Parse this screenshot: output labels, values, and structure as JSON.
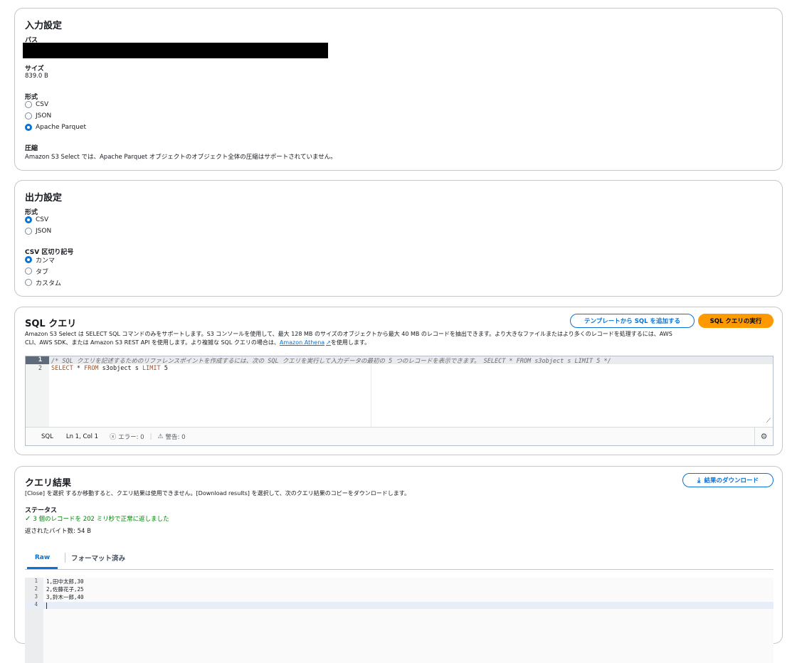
{
  "input": {
    "title": "入力設定",
    "path_label": "パス",
    "size_label": "サイズ",
    "size_value": "839.0 B",
    "format_label": "形式",
    "formats": [
      "CSV",
      "JSON",
      "Apache Parquet"
    ],
    "selected_format": "Apache Parquet",
    "compression_label": "圧縮",
    "compression_note": "Amazon S3 Select では、Apache Parquet オブジェクトのオブジェクト全体の圧縮はサポートされていません。"
  },
  "output": {
    "title": "出力設定",
    "format_label": "形式",
    "formats": [
      "CSV",
      "JSON"
    ],
    "delimiter_label": "CSV 区切り記号",
    "delimiters": [
      "カンマ",
      "タブ",
      "カスタム"
    ]
  },
  "sql": {
    "title": "SQL クエリ",
    "template_button": "テンプレートから SQL を追加する",
    "run_button": "SQL クエリの実行",
    "description_part1": "Amazon S3 Select は SELECT SQL コマンドのみをサポートします。S3 コンソールを使用して、最大 128 MB のサイズのオブジェクトから最大 40 MB のレコードを抽出できます。より大きなファイルまたはより多くのレコードを処理するには、AWS",
    "description_part2": "CLI、AWS SDK、または Amazon S3 REST API を使用します。より複雑な SQL クエリの場合は、",
    "athena_link": "Amazon Athena",
    "description_part3": "を使用します。",
    "line1_num": "1",
    "line2_num": "2",
    "line1": "/* SQL クエリを記述するためのリファレンスポイントを作成するには、次の SQL クエリを実行して入力データの最初の 5 つのレコードを表示できます。 SELECT * FROM s3object s LIMIT 5 */",
    "line2_select": "SELECT",
    "line2_star": " * ",
    "line2_from": "FROM",
    "line2_obj": " s3object s ",
    "line2_limit": "LIMIT",
    "line2_num5": " 5",
    "lang": "SQL",
    "cursor": "Ln 1, Col 1",
    "errors": "エラー: 0",
    "warnings": "警告: 0"
  },
  "results": {
    "title": "クエリ結果",
    "download_button": "結果のダウンロード",
    "note": "[Close] を選択 するか移動すると、クエリ結果は使用できません。[Download results] を選択して、次のクエリ結果のコピーをダウンロードします。",
    "status_label": "ステータス",
    "status_text": "3 個のレコードを 202 ミリ秒で正常に返しました",
    "bytes_text": "返されたバイト数: 54 B",
    "tabs": [
      "Raw",
      "フォーマット済み"
    ],
    "lines": [
      {
        "num": "1",
        "text": "1,田中太郎,30"
      },
      {
        "num": "2",
        "text": "2,佐藤花子,25"
      },
      {
        "num": "3",
        "text": "3,鈴木一郎,40"
      },
      {
        "num": "4",
        "text": ""
      }
    ]
  },
  "colors": {
    "primary": "#0972d3",
    "run_button": "#ff9900",
    "success": "#037f0c"
  }
}
